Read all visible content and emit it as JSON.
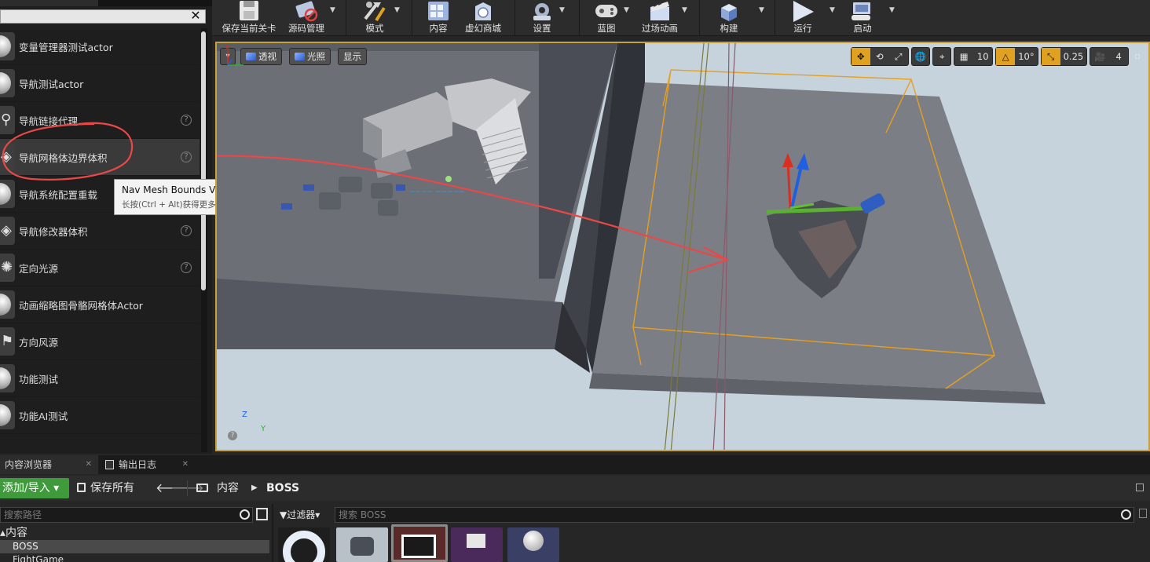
{
  "place_panel": {
    "items": [
      {
        "label": "变量管理器测试actor",
        "icon": "sphere-icon",
        "help": false
      },
      {
        "label": "导航测试actor",
        "icon": "sphere-icon",
        "help": false
      },
      {
        "label": "导航链接代理",
        "icon": "nav-link-icon",
        "help": true
      },
      {
        "label": "导航网格体边界体积",
        "icon": "volume-icon",
        "help": true
      },
      {
        "label": "导航系统配置重载",
        "icon": "sphere-icon",
        "help": false
      },
      {
        "label": "导航修改器体积",
        "icon": "volume-icon",
        "help": true
      },
      {
        "label": "定向光源",
        "icon": "sun-icon",
        "help": true
      },
      {
        "label": "动画缩略图骨骼网格体Actor",
        "icon": "sphere-icon",
        "help": false
      },
      {
        "label": "方向风源",
        "icon": "wind-icon",
        "help": false
      },
      {
        "label": "功能测试",
        "icon": "sphere-icon",
        "help": false
      },
      {
        "label": "功能AI测试",
        "icon": "sphere-icon",
        "help": false
      }
    ],
    "help_glyph": "?",
    "close_glyph": "✕"
  },
  "tooltip": {
    "title": "Nav Mesh Bounds Volume",
    "subtitle": "长按(Ctrl + Alt)获得更多信息"
  },
  "toolbar": {
    "buttons": [
      {
        "id": "save-current-level",
        "label": "保存当前关卡",
        "icon": "save-icon"
      },
      {
        "id": "source-control",
        "label": "源码管理",
        "icon": "source-control-icon"
      },
      {
        "id": "modes",
        "label": "模式",
        "icon": "modes-icon"
      },
      {
        "id": "content",
        "label": "内容",
        "icon": "content-icon"
      },
      {
        "id": "marketplace",
        "label": "虚幻商城",
        "icon": "marketplace-icon"
      },
      {
        "id": "settings",
        "label": "设置",
        "icon": "settings-icon"
      },
      {
        "id": "blueprints",
        "label": "蓝图",
        "icon": "blueprint-icon"
      },
      {
        "id": "cinematics",
        "label": "过场动画",
        "icon": "cinematics-icon"
      },
      {
        "id": "build",
        "label": "构建",
        "icon": "build-icon"
      },
      {
        "id": "play",
        "label": "运行",
        "icon": "play-icon"
      },
      {
        "id": "launch",
        "label": "启动",
        "icon": "launch-icon"
      }
    ]
  },
  "viewport": {
    "menu_glyph": "▾",
    "perspective": "透视",
    "lit": "光照",
    "show": "显示",
    "grid_snap": "10",
    "rotation_snap": "10°",
    "scale_snap": "0.25",
    "camera_speed": "4",
    "axis_x": "Y",
    "axis_z": "Z",
    "help_glyph": "?",
    "accent_color": "#e0a020",
    "annotation_color": "#e84848"
  },
  "content_browser": {
    "tab_content": "内容浏览器",
    "tab_log": "输出日志",
    "tab_close": "✕",
    "add_import": "添加/导入 ▾",
    "save_all": "保存所有",
    "nav_back": "🡐",
    "nav_forward": "🡒",
    "crumb_content": "内容",
    "crumb_sep": "▶",
    "crumb_folder": "BOSS",
    "path_search_placeholder": "搜索路径",
    "filters": "▼过滤器▾",
    "asset_search_placeholder": "搜索 BOSS",
    "tree": {
      "root": "▴内容",
      "selected": "BOSS",
      "next": "FightGame"
    },
    "add_color": "#3e9a3a"
  }
}
